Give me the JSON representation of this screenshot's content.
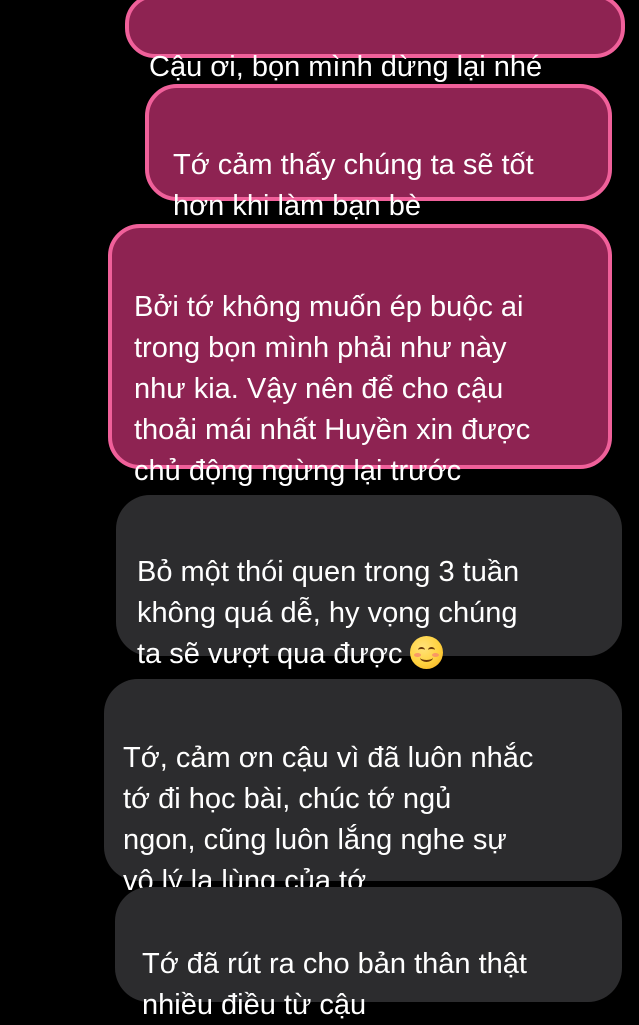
{
  "messages": [
    {
      "id": "b1",
      "style": "highlighted",
      "text": "Cậu ơi, bọn mình dừng lại nhé"
    },
    {
      "id": "b2",
      "style": "highlighted",
      "text": "Tớ cảm thấy chúng ta sẽ tốt\nhơn khi làm bạn bè"
    },
    {
      "id": "b3",
      "style": "highlighted",
      "text": "Bởi tớ không muốn ép buộc ai\ntrong bọn mình phải như này\nnhư kia. Vậy nên để cho cậu\nthoải mái nhất Huyền xin được\nchủ động ngừng lại trước"
    },
    {
      "id": "b4",
      "style": "gray",
      "text": "Bỏ một thói quen trong 3 tuần\nkhông quá dễ, hy vọng chúng\nta sẽ vượt qua được",
      "emoji": "smiling-face-emoji"
    },
    {
      "id": "b5",
      "style": "gray",
      "text": "Tớ, cảm ơn cậu vì đã luôn nhắc\ntớ đi học bài, chúc tớ ngủ\nngon, cũng luôn lắng nghe sự\nvô lý lạ lùng của tớ"
    },
    {
      "id": "b6",
      "style": "gray",
      "text": "Tớ đã rút ra cho bản thân thật\nnhiều điều từ cậu"
    }
  ],
  "colors": {
    "background": "#000000",
    "highlight_fill": "#8e2352",
    "highlight_border": "#f0609a",
    "gray_bubble": "#2c2c2e",
    "text": "#ffffff"
  }
}
